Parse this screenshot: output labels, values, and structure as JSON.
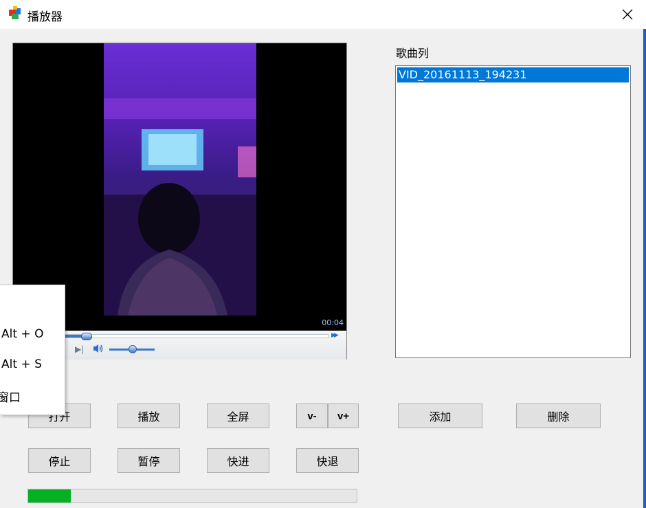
{
  "window": {
    "title": "播放器"
  },
  "player": {
    "time": "00:04",
    "progress_fraction": 0.08,
    "volume_fraction": 0.5
  },
  "playlist": {
    "label": "歌曲列",
    "items": [
      "VID_20161113_194231"
    ],
    "selected_index": 0
  },
  "buttons": {
    "open": "打开",
    "play": "播放",
    "fullscreen": "全屏",
    "vol_down": "v-",
    "vol_up": "v+",
    "add": "添加",
    "delete": "删除",
    "stop": "停止",
    "pause": "暂停",
    "forward": "快进",
    "rewind": "快退"
  },
  "progress_bar": {
    "fraction": 0.13,
    "color": "#06b025"
  },
  "context_menu": {
    "items": [
      "Alt + O",
      "Alt + S",
      "窗口"
    ]
  },
  "colors": {
    "selection": "#0078d7",
    "accent": "#1f5fb4"
  }
}
